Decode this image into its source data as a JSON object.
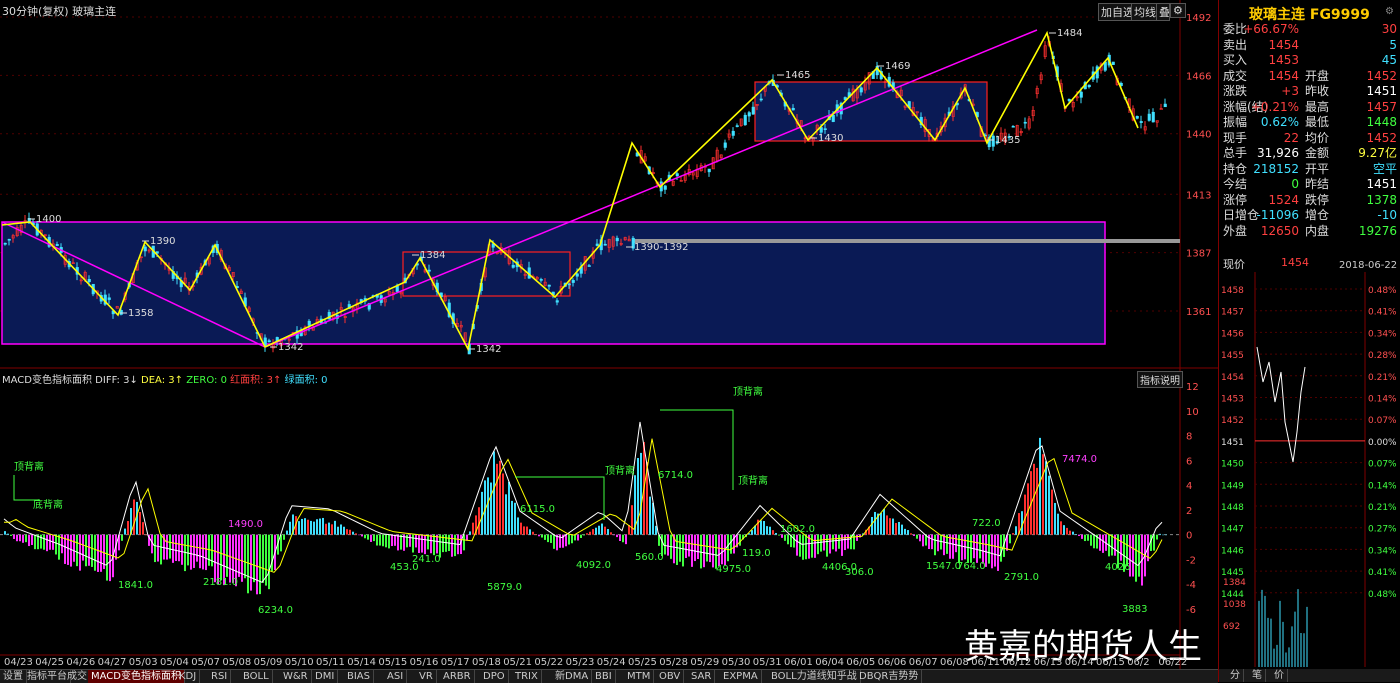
{
  "header": {
    "period": "30分钟(复权)",
    "symbol_name": "玻璃主连",
    "buttons": [
      "加自选",
      "均线",
      "叠加"
    ]
  },
  "price_axis": [
    "1492",
    "1466",
    "1440",
    "1413",
    "1387",
    "1361"
  ],
  "macd_axis": [
    "12",
    "10",
    "8",
    "6",
    "4",
    "2",
    "0",
    "-2",
    "-4",
    "-6"
  ],
  "price_annotations": [
    "1400",
    "1390",
    "1358",
    "1342",
    "1384",
    "1342",
    "1390-1392",
    "1465",
    "1469",
    "1430",
    "1435",
    "1484"
  ],
  "macd_header": {
    "name": "MACD变色指标面积",
    "diff": "DIFF: 3↓",
    "dea": "DEA: 3↑",
    "zero": "ZERO: 0",
    "red_area": "红面积: 3↑",
    "green_area": "绿面积: 0",
    "explain_btn": "指标说明"
  },
  "macd_annotations": [
    "顶背离",
    "底背离",
    "顶背离",
    "顶背离",
    "顶背离",
    "1841.0",
    "2181.0",
    "6234.0",
    "1490.0",
    "453.0",
    "241.0",
    "5879.0",
    "6115.0",
    "4092.0",
    "560.0",
    "6714.0",
    "4975.0",
    "119.0",
    "1602.0",
    "4406.0",
    "306.0",
    "1547.0",
    "764.0",
    "722.0",
    "2791.0",
    "7474.0",
    "4026",
    "3883"
  ],
  "dates": [
    "04/23",
    "04/25",
    "04/26",
    "04/27",
    "05/03",
    "05/04",
    "05/07",
    "05/08",
    "05/09",
    "05/10",
    "05/11",
    "05/14",
    "05/15",
    "05/16",
    "05/17",
    "05/18",
    "05/21",
    "05/22",
    "05/23",
    "05/24",
    "05/25",
    "05/28",
    "05/29",
    "05/30",
    "05/31",
    "06/01",
    "06/04",
    "06/05",
    "06/06",
    "06/07",
    "06/08",
    "06/11",
    "06/12",
    "06/13",
    "06/14",
    "06/15",
    "06/2",
    "06/22"
  ],
  "tabs": [
    "设置",
    "指标平台",
    "成交",
    "MACD变色指标面积",
    "KDJ",
    "RSI",
    "BOLL",
    "W&R",
    "DMI",
    "BIAS",
    "ASI",
    "VR",
    "ARBR",
    "DPO",
    "TRIX",
    "新DMA",
    "BBI",
    "MTM",
    "OBV",
    "SAR",
    "EXPMA",
    "BOLL力道线知乎战",
    "DBQR吉势势"
  ],
  "quote": {
    "title": "玻璃主连",
    "code": "FG9999",
    "rows": [
      {
        "l": "委比",
        "v": "+66.67%",
        "c": "red",
        "v2": "30",
        "c2": "red"
      },
      {
        "l": "卖出",
        "v": "1454",
        "c": "red",
        "v2": "5",
        "c2": "cyan"
      },
      {
        "l": "买入",
        "v": "1453",
        "c": "red",
        "v2": "45",
        "c2": "cyan"
      },
      {
        "l": "成交",
        "v": "1454",
        "c": "red",
        "l2": "开盘",
        "v2": "1452",
        "c2": "red"
      },
      {
        "l": "涨跌",
        "v": "+3",
        "c": "red",
        "l2": "昨收",
        "v2": "1451",
        "c2": "white"
      },
      {
        "l": "涨幅(结)",
        "v": "+0.21%",
        "c": "red",
        "l2": "最高",
        "v2": "1457",
        "c2": "red"
      },
      {
        "l": "振幅",
        "v": "0.62%",
        "c": "cyan",
        "l2": "最低",
        "v2": "1448",
        "c2": "green"
      },
      {
        "l": "现手",
        "v": "22",
        "c": "red",
        "l2": "均价",
        "v2": "1452",
        "c2": "red"
      },
      {
        "l": "总手",
        "v": "31,926",
        "c": "white",
        "l2": "金额",
        "v2": "9.27亿",
        "c2": "yel"
      },
      {
        "l": "持仓",
        "v": "218152",
        "c": "cyan",
        "l2": "开平",
        "v2": "空平",
        "c2": "cyan"
      },
      {
        "l": "今结",
        "v": "0",
        "c": "green",
        "l2": "昨结",
        "v2": "1451",
        "c2": "white"
      },
      {
        "l": "涨停",
        "v": "1524",
        "c": "red",
        "l2": "跌停",
        "v2": "1378",
        "c2": "green"
      },
      {
        "l": "日增仓",
        "v": "-11096",
        "c": "cyan",
        "l2": "增仓",
        "v2": "-10",
        "c2": "cyan"
      },
      {
        "l": "外盘",
        "v": "12650",
        "c": "red",
        "l2": "内盘",
        "v2": "19276",
        "c2": "green"
      }
    ],
    "current_label": "现价",
    "current_price": "1454",
    "date": "2018-06-22 五"
  },
  "mini_chart": {
    "left_axis": [
      "1458",
      "1457",
      "1456",
      "1455",
      "1454",
      "1453",
      "1452",
      "1451",
      "1450",
      "1449",
      "1448",
      "1447",
      "1446",
      "1445",
      "1444"
    ],
    "right_axis": [
      "0.48%",
      "0.41%",
      "0.34%",
      "0.28%",
      "0.21%",
      "0.14%",
      "0.07%",
      "0.00%",
      "0.07%",
      "0.14%",
      "0.21%",
      "0.27%",
      "0.34%",
      "0.41%",
      "0.48%"
    ],
    "vol_axis": [
      "1384",
      "1038",
      "692"
    ],
    "bottom_tabs": [
      "分",
      "笔",
      "价"
    ]
  },
  "watermark": "黄嘉的期货人生",
  "colors": {
    "up": "#ff3030",
    "down": "#40e0ff",
    "zigzag": "#ffff00",
    "trend": "#ff00ff",
    "box": "#0a1a55"
  }
}
